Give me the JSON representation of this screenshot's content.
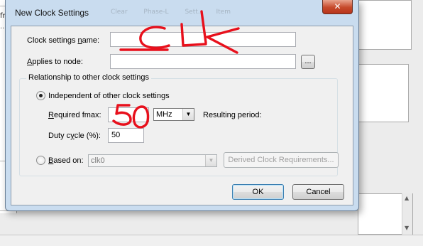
{
  "background": {
    "column_label": "fmax",
    "column_cell": "..."
  },
  "dialog": {
    "title": "New Clock Settings",
    "close_glyph": "✕",
    "ghost_tabs": [
      "Clear",
      "Phase-L",
      "Sett.",
      "Item"
    ],
    "clock_name": {
      "label": "Clock settings name:",
      "value": ""
    },
    "applies_to": {
      "label": "Applies to node:",
      "value": "",
      "browse_label": "..."
    },
    "relationship": {
      "group_label": "Relationship to other clock settings",
      "independent": {
        "label": "Independent of other clock settings",
        "selected": true,
        "fmax_label": "Required fmax:",
        "fmax_value": "",
        "fmax_unit": "MHz",
        "resulting_period_label": "Resulting period:",
        "duty_label": "Duty cycle (%):",
        "duty_value": "50"
      },
      "based_on": {
        "label": "Based on:",
        "selected": false,
        "clock_value": "clk0",
        "derived_button": "Derived Clock Requirements..."
      }
    },
    "ok_label": "OK",
    "cancel_label": "Cancel"
  },
  "handwriting": {
    "name_annotation": "CLK",
    "fmax_annotation": "50",
    "ink_color": "#e8101c"
  }
}
